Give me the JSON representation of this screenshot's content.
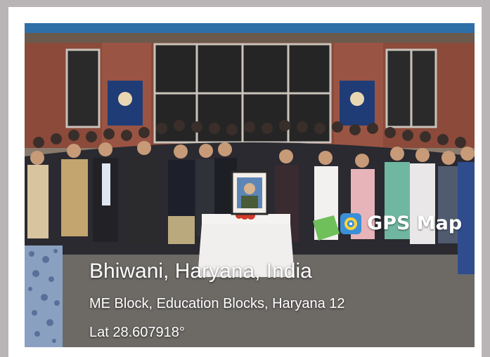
{
  "gps_stamp": {
    "brand": "GPS Map",
    "brand_icon": "map-pin-camera-icon",
    "location_title": "Bhiwani, Haryana, India",
    "address": "ME Block, Education Blocks, Haryana 12",
    "latitude": "Lat 28.607918°"
  },
  "colors": {
    "page_bg": "#b9b5b6",
    "frame_bg": "#ffffff",
    "brick": "#8b4a3a",
    "roof": "#2f6fa8",
    "logo_bg": "#3b8fd6"
  }
}
